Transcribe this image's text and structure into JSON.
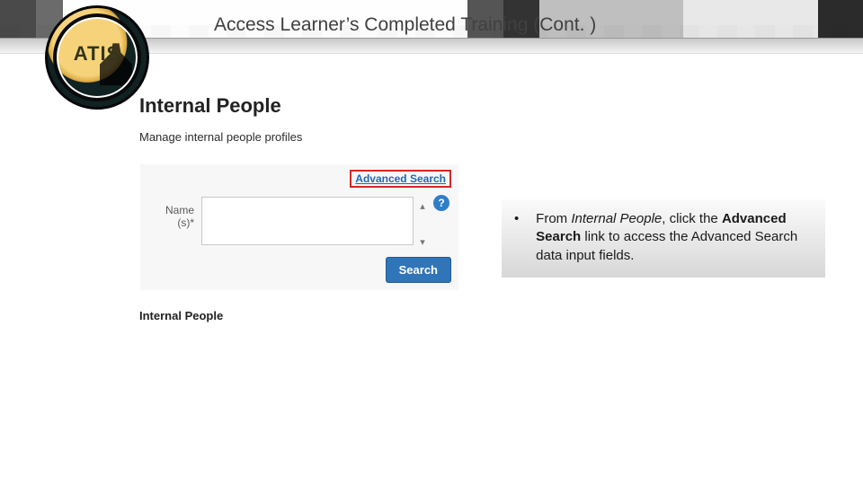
{
  "slide_title": "Access Learner’s Completed Training (Cont. )",
  "logo_text": "ATIS",
  "panel": {
    "heading": "Internal People",
    "subheading": "Manage internal people profiles",
    "advanced_search_label": "Advanced Search",
    "name_label": "Name (s)*",
    "help_symbol": "?",
    "search_button": "Search",
    "below_label": "Internal People"
  },
  "callout": {
    "bullet": "•",
    "pre": "From ",
    "ital": "Internal People",
    "mid1": ", click the ",
    "bold": "Advanced Search",
    "tail": " link to access the Advanced Search data input fields."
  }
}
